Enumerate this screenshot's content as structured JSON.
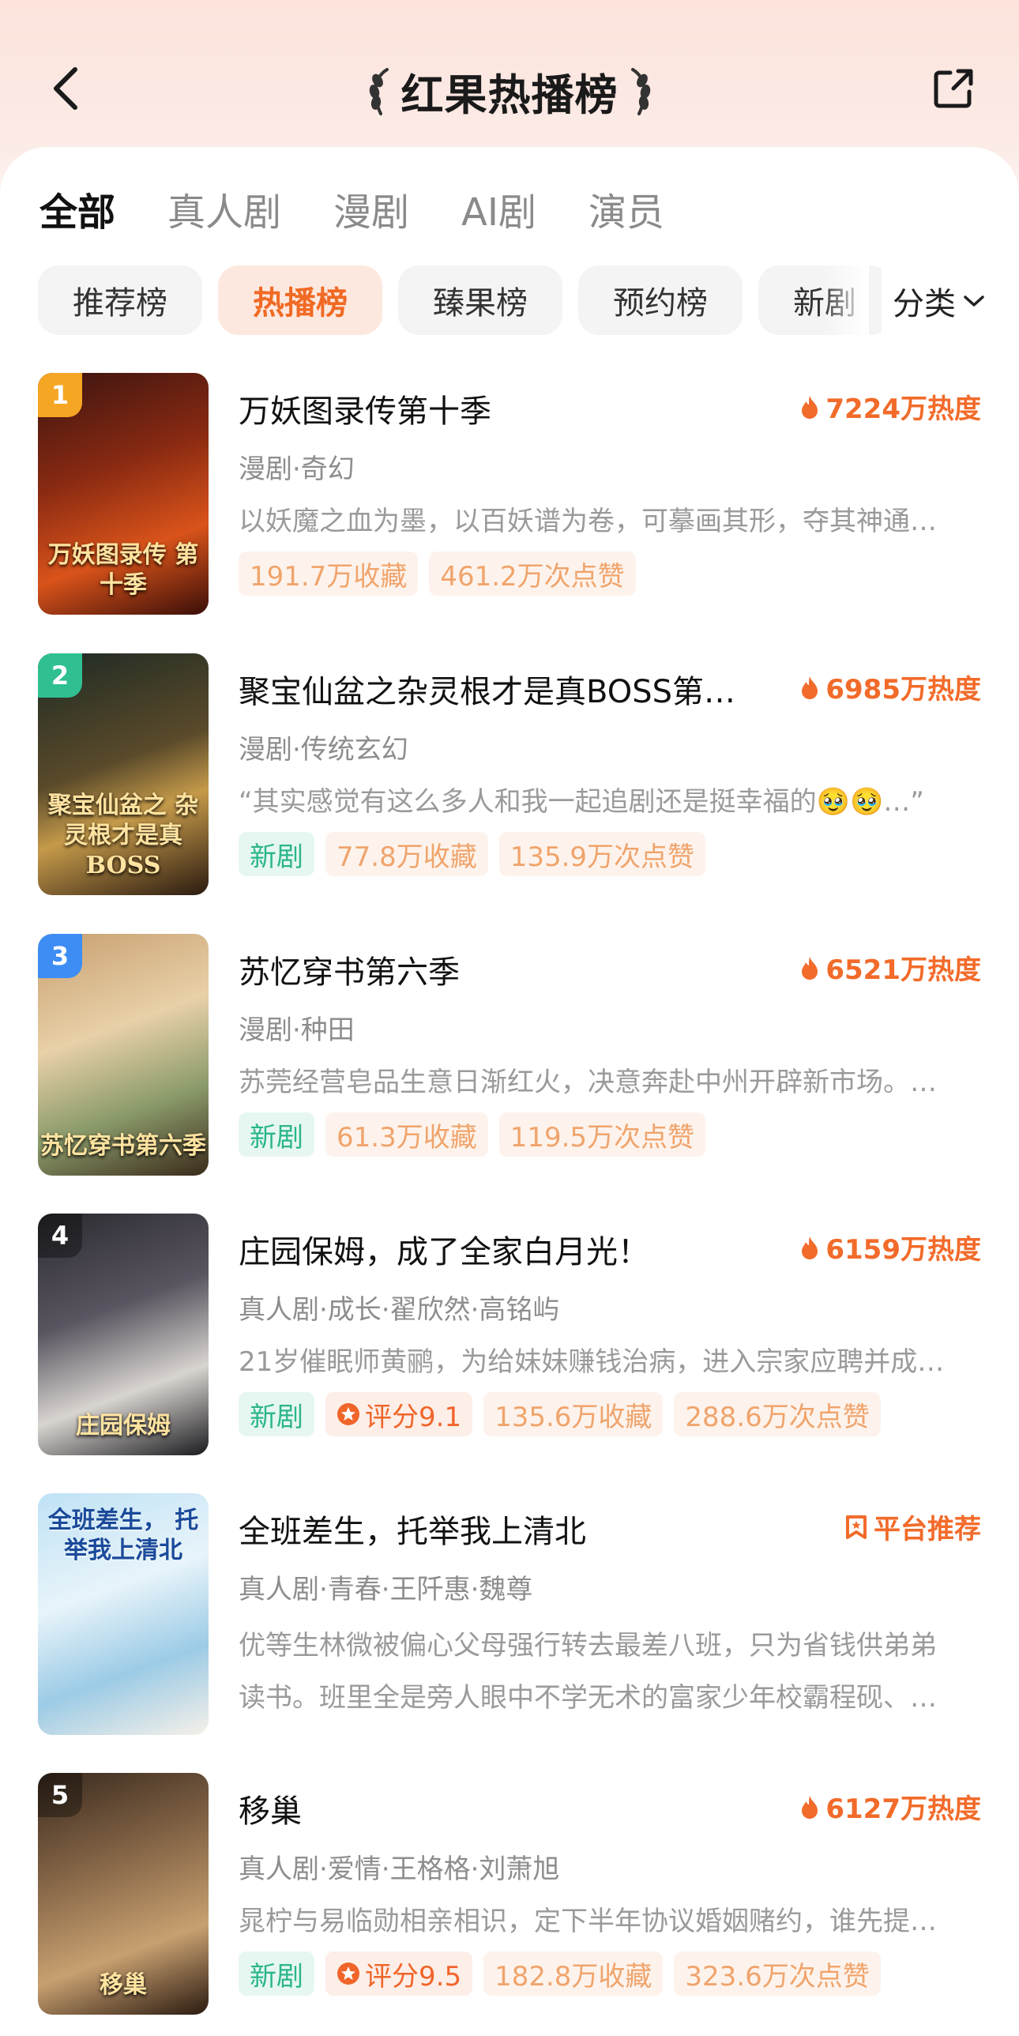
{
  "header": {
    "title": "红果热播榜"
  },
  "tabs": [
    {
      "label": "全部",
      "active": true
    },
    {
      "label": "真人剧",
      "active": false
    },
    {
      "label": "漫剧",
      "active": false
    },
    {
      "label": "AI剧",
      "active": false
    },
    {
      "label": "演员",
      "active": false
    }
  ],
  "chips": [
    {
      "label": "推荐榜",
      "active": false
    },
    {
      "label": "热播榜",
      "active": true
    },
    {
      "label": "臻果榜",
      "active": false
    },
    {
      "label": "预约榜",
      "active": false
    },
    {
      "label": "新剧",
      "active": false
    }
  ],
  "category_label": "分类",
  "colors": {
    "accent": "#f26b2a",
    "new_tag": "#2bb58a"
  },
  "items": [
    {
      "rank": "1",
      "rank_color": "#f5a623",
      "title": "万妖图录传第十季",
      "heat": "7224万热度",
      "genre": "漫剧·奇幻",
      "desc": "以妖魔之血为墨，以百妖谱为卷，可摹画其形，夺其神通…",
      "tags": [
        "191.7万收藏",
        "461.2万次点赞"
      ],
      "cover_text": "万妖图录传 第十季",
      "cover_bg": "linear-gradient(160deg,#3b1410 0%,#8a2a12 40%,#d9531a 70%,#3a0e08 100%)"
    },
    {
      "rank": "2",
      "rank_color": "#2fbf93",
      "title": "聚宝仙盆之杂灵根才是真BOSS第…",
      "heat": "6985万热度",
      "genre": "漫剧·传统玄幻",
      "desc": "“其实感觉有这么多人和我一起追剧还是挺幸福的🥹🥹…”",
      "new": "新剧",
      "tags": [
        "77.8万收藏",
        "135.9万次点赞"
      ],
      "cover_text": "聚宝仙盆之 杂灵根才是真BOSS",
      "cover_bg": "linear-gradient(160deg,#1e2a24 0%,#5a4a2a 45%,#c59a4a 65%,#2a1a10 100%)"
    },
    {
      "rank": "3",
      "rank_color": "#3d8df5",
      "title": "苏忆穿书第六季",
      "heat": "6521万热度",
      "genre": "漫剧·种田",
      "desc": "苏莞经营皂品生意日渐红火，决意奔赴中州开辟新市场。…",
      "new": "新剧",
      "tags": [
        "61.3万收藏",
        "119.5万次点赞"
      ],
      "cover_text": "苏忆穿书第六季",
      "cover_bg": "linear-gradient(160deg,#c8a070 0%,#e8d0a8 40%,#8a9a6a 70%,#3a2a1a 100%)"
    },
    {
      "rank": "4",
      "rank_color": "rgba(0,0,0,0.35)",
      "title": "庄园保姆，成了全家白月光！",
      "heat": "6159万热度",
      "genre": "真人剧·成长·翟欣然·高铭屿",
      "desc": "21岁催眠师黄鹂，为给妹妹赚钱治病，进入宗家应聘并成…",
      "new": "新剧",
      "rating": "评分9.1",
      "tags": [
        "135.6万收藏",
        "288.6万次点赞"
      ],
      "cover_text": "庄园保姆",
      "cover_bg": "linear-gradient(160deg,#2a2a30 0%,#5a5560 40%,#d8d4d0 70%,#1a1a1e 100%)"
    },
    {
      "rank": "",
      "rank_color": "",
      "title": "全班差生，托举我上清北",
      "badge": "平台推荐",
      "genre": "真人剧·青春·王阡惠·魏尊",
      "desc_lines": [
        "优等生林微被偏心父母强行转去最差八班，只为省钱供弟弟",
        "读书。班里全是旁人眼中不学无术的富家少年校霸程砚、…"
      ],
      "tags": [],
      "cover_text": "全班差生， 托举我上清北",
      "cover_bg": "linear-gradient(160deg,#bfe2f5 0%,#e8f4fa 40%,#9ccbe6 70%,#f5f0e8 100%)"
    },
    {
      "rank": "5",
      "rank_color": "rgba(0,0,0,0.35)",
      "title": "移巢",
      "heat": "6127万热度",
      "genre": "真人剧·爱情·王格格·刘萧旭",
      "desc": "晁柠与易临勋相亲相识，定下半年协议婚姻赌约，谁先提…",
      "new": "新剧",
      "rating": "评分9.5",
      "tags": [
        "182.8万收藏",
        "323.6万次点赞"
      ],
      "cover_text": "移巢",
      "cover_bg": "linear-gradient(160deg,#3a2a1e 0%,#8a6a4a 40%,#c8a070 70%,#2a1a10 100%)"
    }
  ]
}
